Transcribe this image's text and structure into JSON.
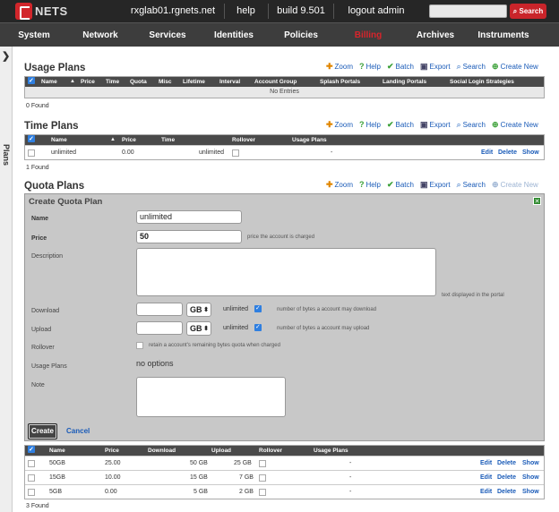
{
  "topbar": {
    "logo_text": "NETS",
    "host": "rxglab01.rgnets.net",
    "help": "help",
    "build": "build 9.501",
    "logout": "logout admin",
    "search_placeholder": "",
    "search_button": "Search",
    "search_icon": "magnifier-icon"
  },
  "nav": {
    "items": [
      "System",
      "Network",
      "Services",
      "Identities",
      "Policies",
      "Billing",
      "Archives",
      "Instruments"
    ],
    "active": "Billing",
    "active_color": "#d8242b"
  },
  "sidebar": {
    "label": "Plans",
    "toggle_icon": "chevron-right-icon"
  },
  "toolbar": {
    "zoom": "Zoom",
    "help": "Help",
    "batch": "Batch",
    "export": "Export",
    "search": "Search",
    "create_new": "Create New"
  },
  "usage_plans": {
    "title": "Usage Plans",
    "columns": [
      "Name",
      "Price",
      "Time",
      "Quota",
      "Misc",
      "Lifetime",
      "Interval",
      "Account Group",
      "Splash Portals",
      "Landing Portals",
      "Social Login Strategies"
    ],
    "empty_text": "No Entries",
    "count": "0 Found"
  },
  "time_plans": {
    "title": "Time Plans",
    "columns": [
      "Name",
      "Price",
      "Time",
      "Rollover",
      "Usage Plans"
    ],
    "rows": [
      {
        "name": "unlimited",
        "price": "0.00",
        "time": "unlimited",
        "usage_plans": "-",
        "edit": "Edit",
        "delete": "Delete",
        "show": "Show"
      }
    ],
    "count": "1 Found"
  },
  "quota_plans": {
    "title": "Quota Plans",
    "columns": [
      "Name",
      "Price",
      "Download",
      "Upload",
      "Rollover",
      "Usage Plans"
    ],
    "rows": [
      {
        "name": "50GB",
        "price": "25.00",
        "download": "50 GB",
        "upload": "25 GB",
        "usage_plans": "-",
        "edit": "Edit",
        "delete": "Delete",
        "show": "Show"
      },
      {
        "name": "15GB",
        "price": "10.00",
        "download": "15 GB",
        "upload": "7 GB",
        "usage_plans": "-",
        "edit": "Edit",
        "delete": "Delete",
        "show": "Show"
      },
      {
        "name": "5GB",
        "price": "0.00",
        "download": "5 GB",
        "upload": "2 GB",
        "usage_plans": "-",
        "edit": "Edit",
        "delete": "Delete",
        "show": "Show"
      }
    ],
    "count": "3 Found"
  },
  "form": {
    "title": "Create Quota Plan",
    "close_icon": "close-x-icon",
    "name_label": "Name",
    "name_value": "unlimited",
    "price_label": "Price",
    "price_value": "50",
    "price_hint": "price the account is charged",
    "description_label": "Description",
    "description_hint": "text displayed in the portal",
    "download_label": "Download",
    "download_value": "",
    "download_unit": "GB",
    "download_unlimited": "unlimited",
    "download_hint": "number of bytes a account may download",
    "upload_label": "Upload",
    "upload_value": "",
    "upload_unit": "GB",
    "upload_unlimited": "unlimited",
    "upload_hint": "number of bytes a account may upload",
    "rollover_label": "Rollover",
    "rollover_hint": "retain a account's remaining bytes quota when charged",
    "usage_plans_label": "Usage Plans",
    "usage_plans_value": "no options",
    "note_label": "Note",
    "create_button": "Create",
    "cancel_button": "Cancel"
  }
}
